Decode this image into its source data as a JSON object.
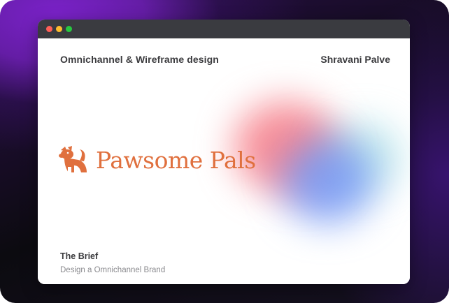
{
  "window": {
    "controls": [
      "close",
      "minimize",
      "maximize"
    ]
  },
  "header": {
    "project_title": "Omnichannel & Wireframe design",
    "author": "Shravani Palve"
  },
  "brand": {
    "name": "Pawsome Pals",
    "logo_icon": "dog-logo-icon",
    "color": "#e0703e"
  },
  "brief": {
    "title": "The Brief",
    "text": "Design a Omnichannel Brand"
  },
  "colors": {
    "accent_purple": "#7a22c8",
    "brand_orange": "#e0703e",
    "titlebar": "#3a3b40"
  }
}
